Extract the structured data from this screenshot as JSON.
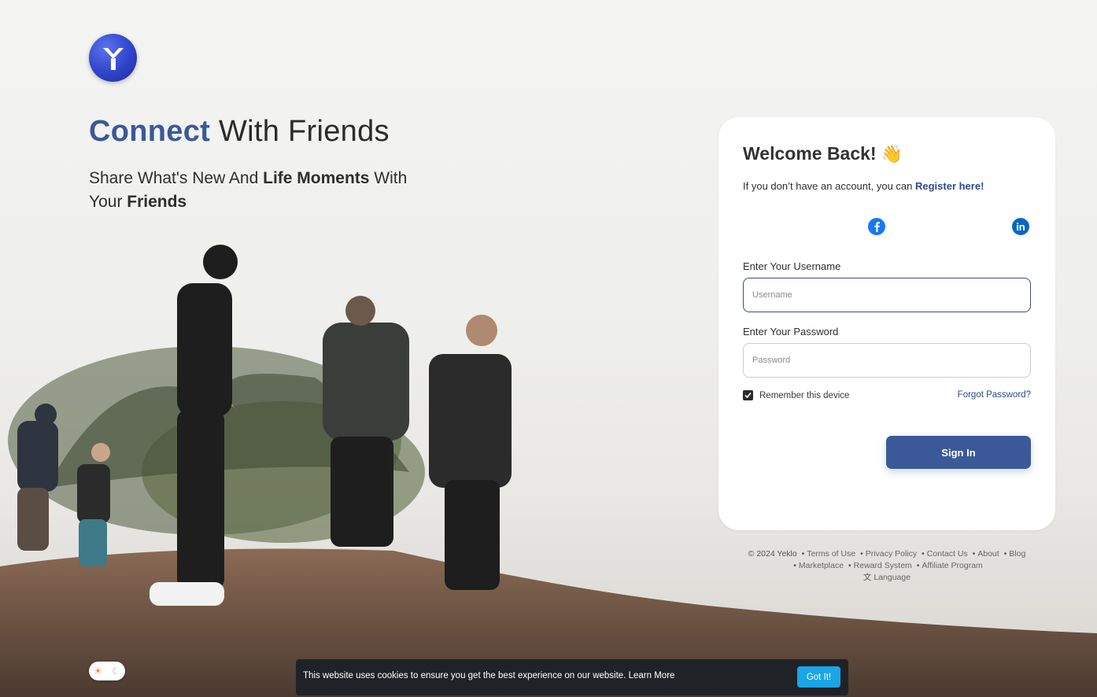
{
  "brand": {
    "logo_icon": "yeklo-logo-icon",
    "accent_color": "#3b5998"
  },
  "hero": {
    "headline_accent": "Connect",
    "headline_rest": " With Friends",
    "sub_part1": "Share What's New And ",
    "sub_bold1": "Life Moments",
    "sub_part2": " With Your ",
    "sub_bold2": "Friends"
  },
  "login": {
    "title": "Welcome Back!",
    "title_emoji": "👋",
    "register_text": "If you don’t have an account, you can ",
    "register_link": "Register here!",
    "social": [
      {
        "name": "facebook",
        "icon": "facebook-icon"
      },
      {
        "name": "linkedin",
        "icon": "linkedin-icon"
      }
    ],
    "username_label": "Enter Your Username",
    "username_placeholder": "Username",
    "username_value": "",
    "password_label": "Enter Your Password",
    "password_placeholder": "Password",
    "password_value": "",
    "remember_label": "Remember this device",
    "remember_checked": true,
    "forgot_label": "Forgot Password?",
    "signin_label": "Sign In"
  },
  "footer": {
    "copyright": "© 2024 Yeklo",
    "links_row1": [
      "Terms of Use",
      "Privacy Policy",
      "Contact Us",
      "About",
      "Blog"
    ],
    "links_row2": [
      "Marketplace",
      "Reward System",
      "Affiliate Program"
    ],
    "language": "Language",
    "language_icon": "translate-icon"
  },
  "theme_toggle": {
    "light_icon": "sun-icon",
    "dark_icon": "moon-icon"
  },
  "cookie": {
    "text": "This website uses cookies to ensure you get the best experience on our website.",
    "learn_more": "Learn More",
    "button": "Got It!"
  }
}
